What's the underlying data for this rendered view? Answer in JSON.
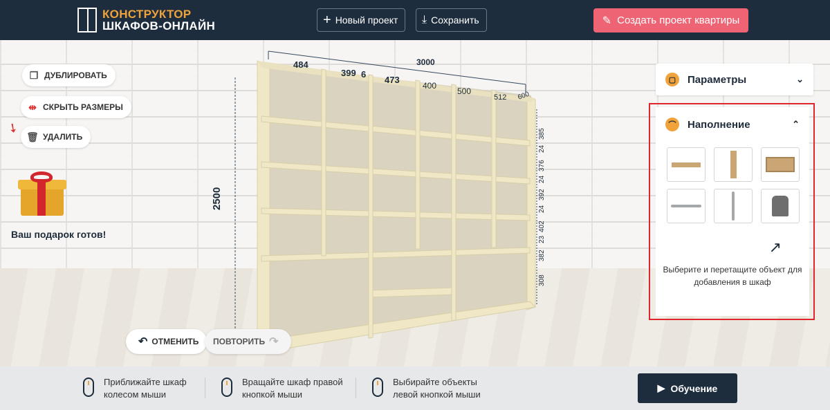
{
  "header": {
    "logo_line1": "КОНСТРУКТОР",
    "logo_line2": "ШКАФОВ-ОНЛАЙН",
    "new_project_label": "Новый проект",
    "save_label": "Сохранить",
    "create_apartment_label": "Создать проект квартиры"
  },
  "tools": {
    "duplicate_label": "ДУБЛИРОВАТЬ",
    "hide_dims_label": "СКРЫТЬ РАЗМЕРЫ",
    "delete_label": "УДАЛИТЬ"
  },
  "gift": {
    "label": "Ваш подарок готов!"
  },
  "history": {
    "undo_label": "ОТМЕНИТЬ",
    "redo_label": "ПОВТОРИТЬ"
  },
  "dimensions": {
    "total_width": "3000",
    "height": "2500",
    "depth": "600",
    "columns": [
      "484",
      "399",
      "6",
      "473",
      "400",
      "500",
      "512"
    ],
    "rows": [
      "385",
      "24",
      "376",
      "24",
      "392",
      "24",
      "402",
      "23",
      "382",
      "308"
    ]
  },
  "panel": {
    "parameters_label": "Параметры",
    "filling_label": "Наполнение",
    "hint": "Выберите и перетащите объект для добавления в шкаф",
    "objects": [
      "shelf",
      "side-panel",
      "drawer",
      "hanger-rod",
      "vertical-rod",
      "clothes-hanger"
    ]
  },
  "footer": {
    "tip1": "Приближайте шкаф колесом мыши",
    "tip2": "Вращайте шкаф правой кнопкой мыши",
    "tip3": "Выбирайте объекты левой кнопкой мыши",
    "learn_label": "Обучение"
  },
  "colors": {
    "header_bg": "#1e2d3d",
    "accent": "#f0a23b",
    "pink": "#ef6474",
    "highlight": "#e0262c",
    "wood": "#efe7c6"
  }
}
